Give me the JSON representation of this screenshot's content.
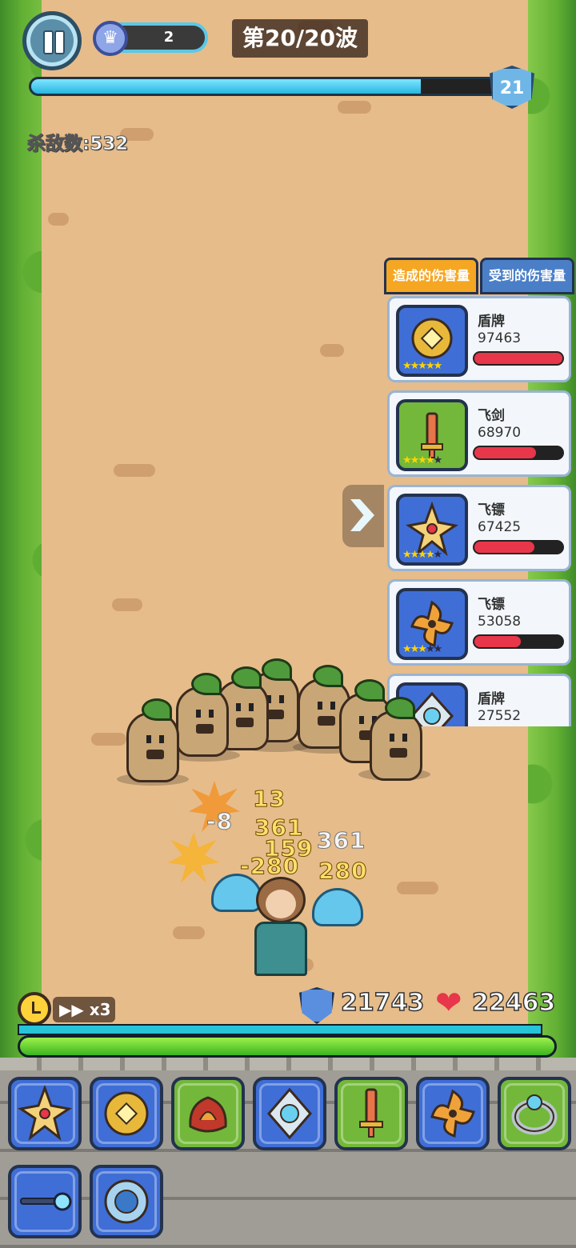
{
  "hud": {
    "crown_count": "2",
    "wave_text": "第20/20波",
    "xp_progress": 0.82,
    "level": "21",
    "kills_text": "杀敌数:532"
  },
  "damage_panel": {
    "tab_dealt": "造成的伤害量",
    "tab_taken": "受到的伤害量",
    "items": [
      {
        "name": "盾牌",
        "value": "97463",
        "fraction": 1.0,
        "stars": 5,
        "icon": "golden-shield-icon",
        "bg": "blue"
      },
      {
        "name": "飞剑",
        "value": "68970",
        "fraction": 0.71,
        "stars": 4,
        "icon": "flying-sword-icon",
        "bg": "green"
      },
      {
        "name": "飞镖",
        "value": "67425",
        "fraction": 0.69,
        "stars": 4,
        "icon": "star-shuriken-icon",
        "bg": "blue"
      },
      {
        "name": "飞镖",
        "value": "53058",
        "fraction": 0.54,
        "stars": 3,
        "icon": "curved-shuriken-icon",
        "bg": "blue"
      },
      {
        "name": "盾牌",
        "value": "27552",
        "fraction": 0.28,
        "stars": 3,
        "icon": "silver-shield-icon",
        "bg": "blue"
      }
    ]
  },
  "combat_text": [
    "13",
    "-8",
    "361",
    "159",
    "361",
    "-280",
    "280"
  ],
  "status": {
    "speed_label": "x3",
    "shield_value": "21743",
    "hp_value": "22463",
    "shield_fraction": 1.0,
    "hp_fraction": 1.0
  },
  "skills": [
    {
      "icon": "star-shuriken-icon",
      "bg": "blue"
    },
    {
      "icon": "golden-shield-icon",
      "bg": "blue"
    },
    {
      "icon": "flame-gauntlet-icon",
      "bg": "green"
    },
    {
      "icon": "silver-shield-icon",
      "bg": "blue"
    },
    {
      "icon": "flying-sword-icon",
      "bg": "green"
    },
    {
      "icon": "curved-shuriken-icon",
      "bg": "blue"
    },
    {
      "icon": "silver-ring-icon",
      "bg": "green"
    },
    {
      "icon": "magic-wand-icon",
      "bg": "blue"
    },
    {
      "icon": "round-shield-icon",
      "bg": "blue"
    }
  ],
  "colors": {
    "road": "#e6bc8a",
    "grass": "#62b034",
    "hp_bar": "#3bb51f",
    "shield_bar": "#27c4d8",
    "damage_bar": "#e8364a",
    "tab_active": "#f5a623",
    "tab_inactive": "#4a7fc8"
  }
}
